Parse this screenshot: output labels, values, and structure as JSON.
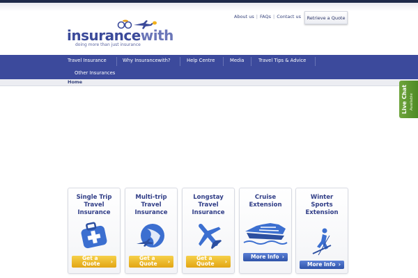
{
  "header": {
    "util_links": [
      "About us",
      "FAQs",
      "Contact us"
    ],
    "retrieve_button": "Retrieve a Quote",
    "logo": {
      "word_dark": "insurance",
      "word_light": "with",
      "tagline": "doing more than just insurance"
    }
  },
  "nav": {
    "items": [
      "Travel Insurance",
      "Why Insurancewith?",
      "Help Centre",
      "Media",
      "Travel Tips & Advice",
      "Other Insurances"
    ]
  },
  "breadcrumb": "Home",
  "live_chat": {
    "title": "Live Chat",
    "status": "Available"
  },
  "cards": [
    {
      "title": [
        "Single Trip",
        "Travel",
        "Insurance"
      ],
      "button": [
        "Get a",
        "Quote"
      ],
      "icon": "medical-bag-icon"
    },
    {
      "title": [
        "Multi-trip",
        "Travel",
        "Insurance"
      ],
      "button": [
        "Get a",
        "Quote"
      ],
      "icon": "globe-plane-icon"
    },
    {
      "title": [
        "Longstay",
        "Travel",
        "Insurance"
      ],
      "button": [
        "Get a",
        "Quote"
      ],
      "icon": "airplane-icon"
    },
    {
      "title": [
        "Cruise",
        "Extension"
      ],
      "button": [
        "More Info"
      ],
      "icon": "cruise-ship-icon"
    },
    {
      "title": [
        "Winter",
        "Sports",
        "Extension"
      ],
      "button": [
        "More Info"
      ],
      "icon": "skier-icon"
    }
  ],
  "colors": {
    "nav": "#3c4a9c",
    "brand": "#3b4a9a",
    "quote_button": "#e9b525",
    "info_button": "#3f63b8",
    "live_chat": "#5e9a30"
  }
}
